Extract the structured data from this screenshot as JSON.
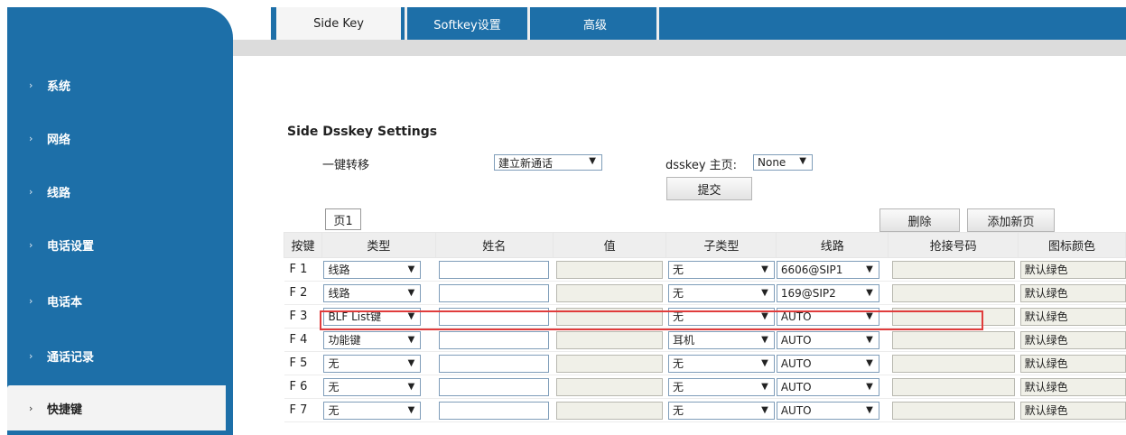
{
  "sidebar": {
    "items": [
      {
        "label": "系统"
      },
      {
        "label": "网络"
      },
      {
        "label": "线路"
      },
      {
        "label": "电话设置"
      },
      {
        "label": "电话本"
      },
      {
        "label": "通话记录"
      },
      {
        "label": "快捷键"
      }
    ],
    "chevron": "›"
  },
  "tabs": {
    "sidekey": "Side Key",
    "softkey": "Softkey设置",
    "advanced": "高级"
  },
  "settings": {
    "title": "Side Dsskey Settings",
    "onekey_label": "一键转移",
    "onekey_value": "建立新通话",
    "dsskey_label": "dsskey 主页:",
    "dsskey_value": "None",
    "submit": "提交",
    "page_tab": "页1",
    "delete": "删除",
    "add_page": "添加新页"
  },
  "table": {
    "headers": [
      "按键",
      "类型",
      "姓名",
      "值",
      "子类型",
      "线路",
      "抢接号码",
      "图标颜色"
    ],
    "rows": [
      {
        "key": "F 1",
        "type": "线路",
        "subtype": "无",
        "line": "6606@SIP1",
        "color": "默认绿色"
      },
      {
        "key": "F 2",
        "type": "线路",
        "subtype": "无",
        "line": "169@SIP2",
        "color": "默认绿色"
      },
      {
        "key": "F 3",
        "type": "BLF List键",
        "subtype": "无",
        "line": "AUTO",
        "color": "默认绿色"
      },
      {
        "key": "F 4",
        "type": "功能键",
        "subtype": "耳机",
        "line": "AUTO",
        "color": "默认绿色"
      },
      {
        "key": "F 5",
        "type": "无",
        "subtype": "无",
        "line": "AUTO",
        "color": "默认绿色"
      },
      {
        "key": "F 6",
        "type": "无",
        "subtype": "无",
        "line": "AUTO",
        "color": "默认绿色"
      },
      {
        "key": "F 7",
        "type": "无",
        "subtype": "无",
        "line": "AUTO",
        "color": "默认绿色"
      }
    ]
  },
  "colors": {
    "brand": "#1d6fa8",
    "highlight": "#e03c3c"
  }
}
